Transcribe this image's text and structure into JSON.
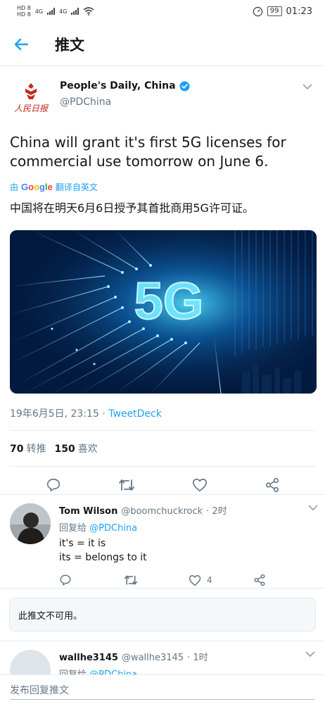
{
  "status_bar": {
    "sim1": "HD 8",
    "sim2": "HD 8",
    "net1": "4G",
    "net2": "4G",
    "battery": "99",
    "time": "01:23"
  },
  "header": {
    "title": "推文"
  },
  "tweet": {
    "author_name": "People's Daily, China",
    "author_handle": "@PDChina",
    "logo_text": "人民日报",
    "text": "China will grant it's first 5G licenses for commercial use tomorrow on June 6.",
    "translate_prefix": "由",
    "translate_brand": "Google",
    "translate_suffix": "翻译自英文",
    "translated_text": "中国将在明天6月6日授予其首批商用5G许可证。",
    "media_label": "5G",
    "timestamp": "19年6月5日, 23:15 · ",
    "source": "TweetDeck",
    "retweets_count": "70",
    "retweets_label": "转推",
    "likes_count": "150",
    "likes_label": "喜欢"
  },
  "replies": [
    {
      "name": "Tom Wilson",
      "handle": "@boomchuckrock",
      "time": "· 2时",
      "reply_prefix": "回复给",
      "reply_to": "@PDChina",
      "line1": "it's = it is",
      "line2": "its = belongs to it",
      "like_count": "4"
    },
    {
      "name": "wallhe3145",
      "handle": "@wallhe3145",
      "time": "· 1时",
      "reply_prefix": "回复给",
      "reply_to": "@PDChina"
    }
  ],
  "unavailable_text": "此推文不可用。",
  "compose": {
    "placeholder": "发布回复推文"
  },
  "colors": {
    "accent": "#1da1f2",
    "muted": "#657786",
    "text": "#14171a",
    "logo_red": "#c3281e"
  }
}
